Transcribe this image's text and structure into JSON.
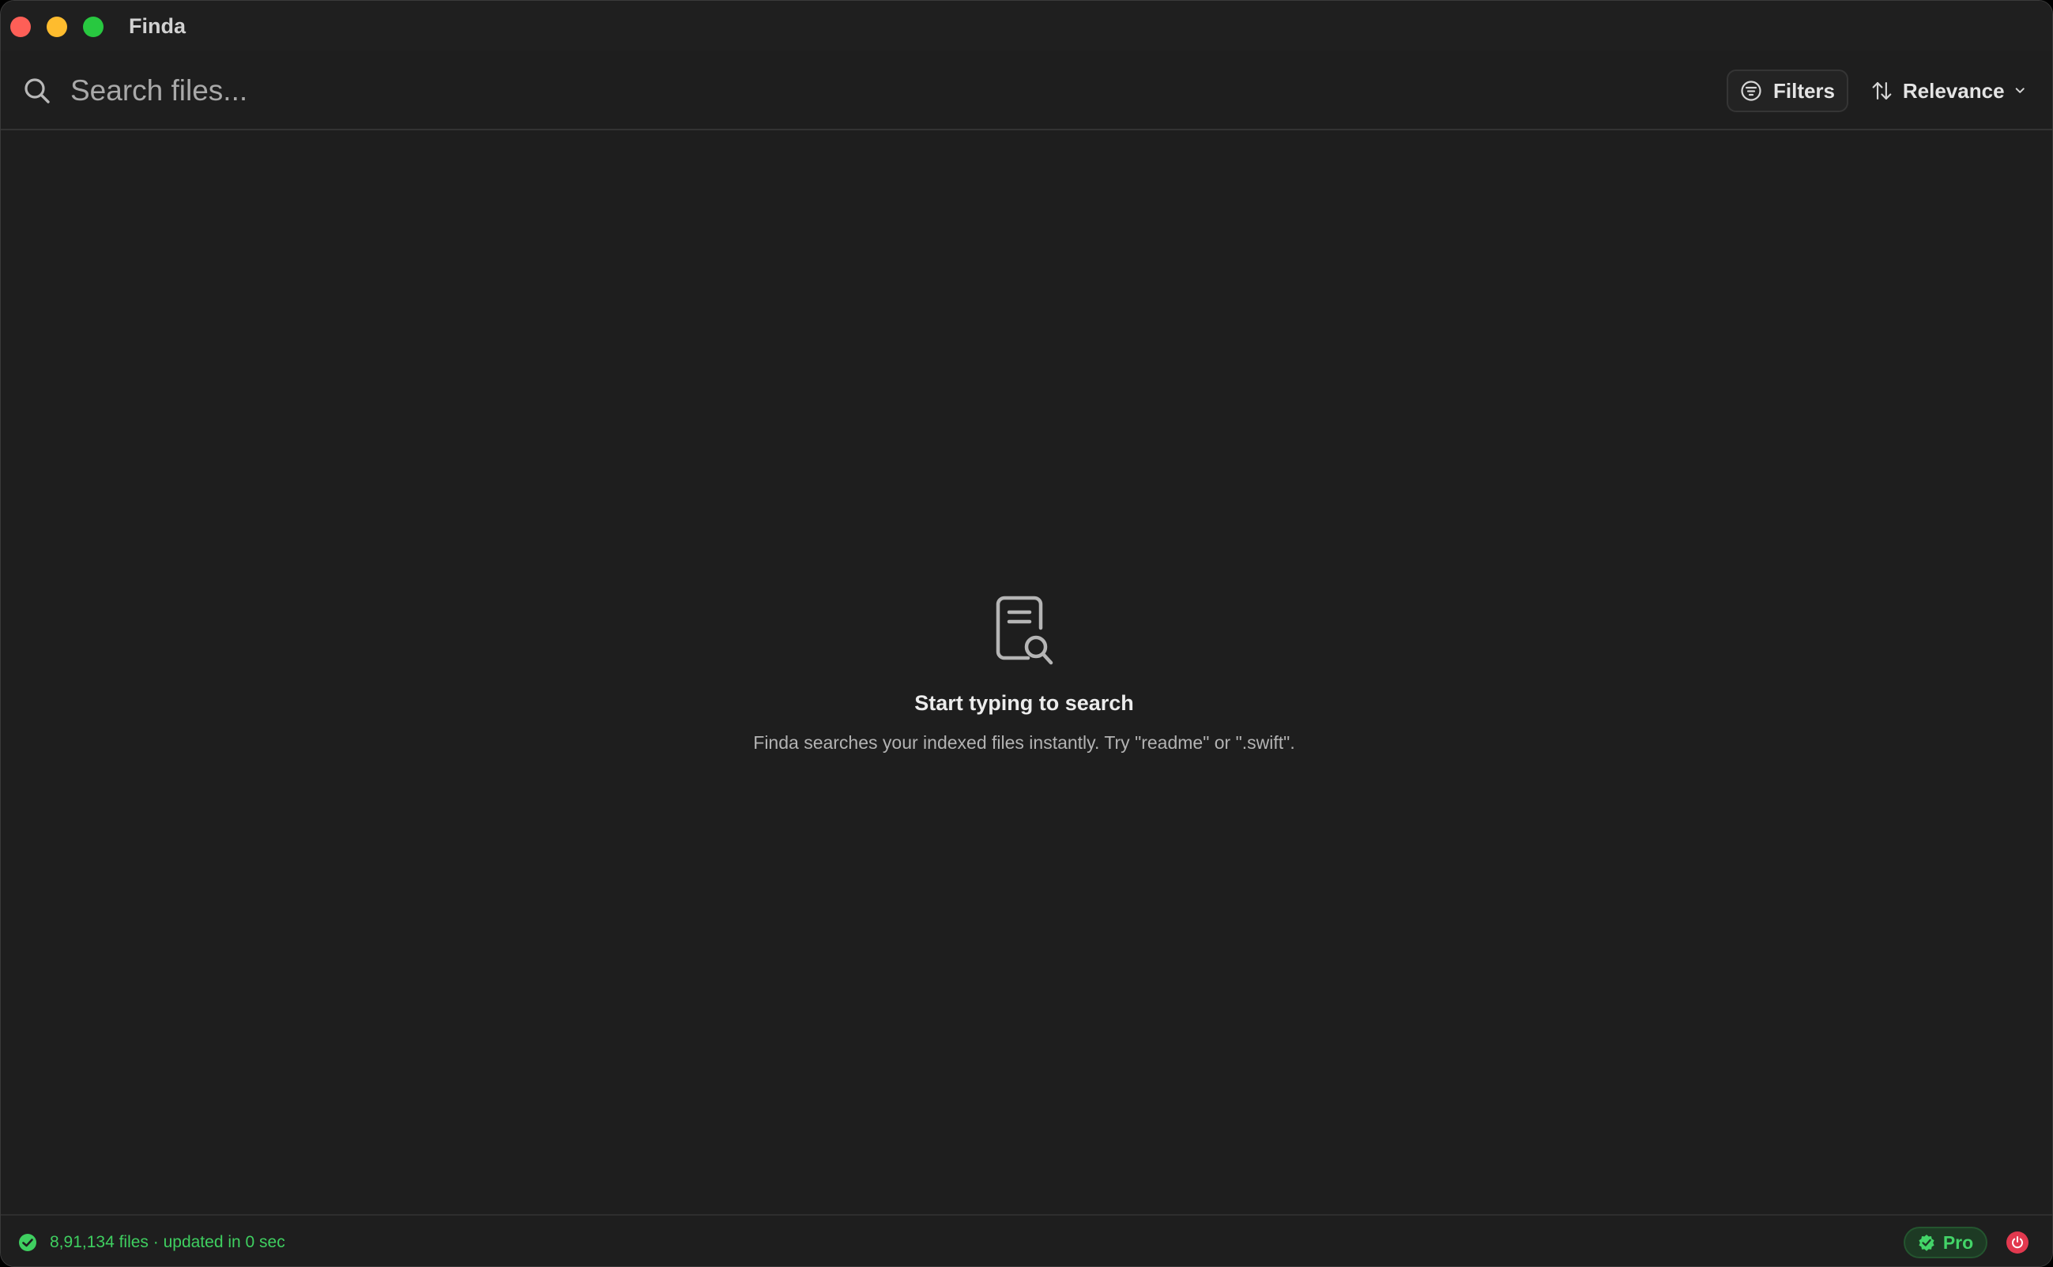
{
  "window": {
    "title": "Finda"
  },
  "search": {
    "placeholder": "Search files...",
    "value": ""
  },
  "toolbar": {
    "filters_label": "Filters",
    "sort_label": "Relevance"
  },
  "empty_state": {
    "title": "Start typing to search",
    "subtitle": "Finda searches your indexed files instantly. Try \"readme\" or \".swift\"."
  },
  "status": {
    "text": "8,91,134 files · updated in 0 sec",
    "badge_label": "Pro"
  },
  "icons": {
    "search": "search-icon",
    "filters": "filter-lines-icon",
    "sort": "sort-arrows-icon",
    "sort_caret": "chevron-down-icon",
    "empty": "document-search-icon",
    "status": "check-circle-icon",
    "badge": "verified-badge-icon",
    "power": "power-icon"
  },
  "colors": {
    "background": "#1e1e1e",
    "accent_green": "#3fcf60",
    "close": "#fe5f57",
    "minimize": "#febc2e",
    "maximize": "#28c840",
    "power": "#e2394f"
  }
}
